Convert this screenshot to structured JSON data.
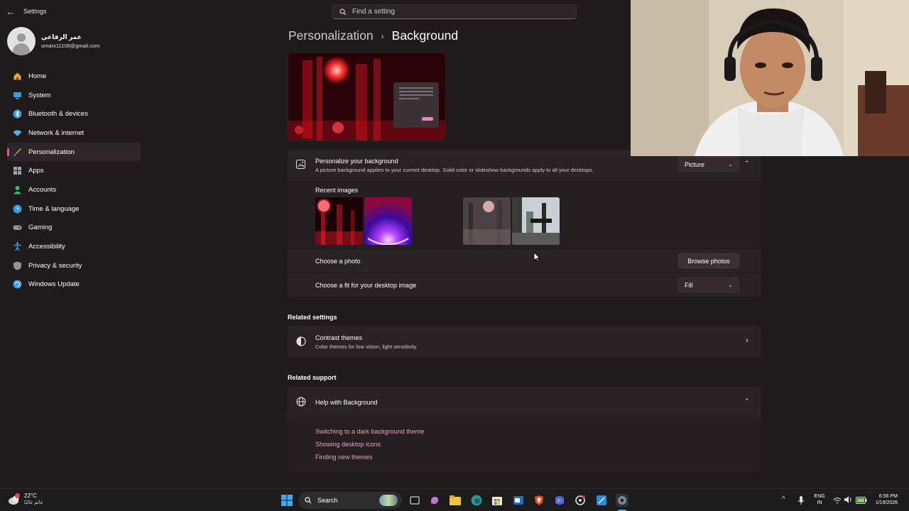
{
  "app": {
    "title": "Settings"
  },
  "search": {
    "placeholder": "Find a setting"
  },
  "profile": {
    "name": "عمر الرفاعي",
    "email": "omarx11108@gmail.com"
  },
  "nav": {
    "items": [
      {
        "label": "Home",
        "icon": "home-icon",
        "color": "#e8a33d"
      },
      {
        "label": "System",
        "icon": "system-icon",
        "color": "#3a9be0"
      },
      {
        "label": "Bluetooth & devices",
        "icon": "bluetooth-icon",
        "color": "#3a9be0"
      },
      {
        "label": "Network & internet",
        "icon": "network-icon",
        "color": "#5ab0e8"
      },
      {
        "label": "Personalization",
        "icon": "brush-icon",
        "color": "#e8a33d",
        "active": true
      },
      {
        "label": "Apps",
        "icon": "apps-icon",
        "color": "#9aa3ad"
      },
      {
        "label": "Accounts",
        "icon": "accounts-icon",
        "color": "#2fbf71"
      },
      {
        "label": "Time & language",
        "icon": "globe-clock-icon",
        "color": "#3a9be0"
      },
      {
        "label": "Gaming",
        "icon": "gaming-icon",
        "color": "#8f959c"
      },
      {
        "label": "Accessibility",
        "icon": "accessibility-icon",
        "color": "#3a9be0"
      },
      {
        "label": "Privacy & security",
        "icon": "shield-icon",
        "color": "#8f959c"
      },
      {
        "label": "Windows Update",
        "icon": "update-icon",
        "color": "#3a9be0"
      }
    ]
  },
  "breadcrumb": {
    "parent": "Personalization",
    "separator": "›",
    "current": "Background"
  },
  "background_card": {
    "title": "Personalize your background",
    "subtitle": "A picture background applies to your current desktop. Solid color or slideshow backgrounds apply to all your desktops.",
    "type_value": "Picture",
    "recent_label": "Recent images",
    "choose_photo_label": "Choose a photo",
    "browse_label": "Browse photos",
    "fit_label": "Choose a fit for your desktop image",
    "fit_value": "Fill"
  },
  "related_settings": {
    "label": "Related settings",
    "contrast_title": "Contrast themes",
    "contrast_sub": "Color themes for low vision, light sensitivity"
  },
  "related_support": {
    "label": "Related support",
    "help_title": "Help with Background",
    "links": [
      "Switching to a dark background theme",
      "Showing desktop icons",
      "Finding new themes"
    ]
  },
  "taskbar": {
    "weather_temp": "22°C",
    "weather_desc": "غائم غالبًا",
    "search_label": "Search",
    "lang_line1": "ENG",
    "lang_line2": "IN",
    "time": "6:56 PM",
    "date": "1/19/2026"
  },
  "colors": {
    "accent": "#e25a88",
    "link": "#e8a2c2",
    "background": "#1f1a1c",
    "card": "#2a2326"
  }
}
